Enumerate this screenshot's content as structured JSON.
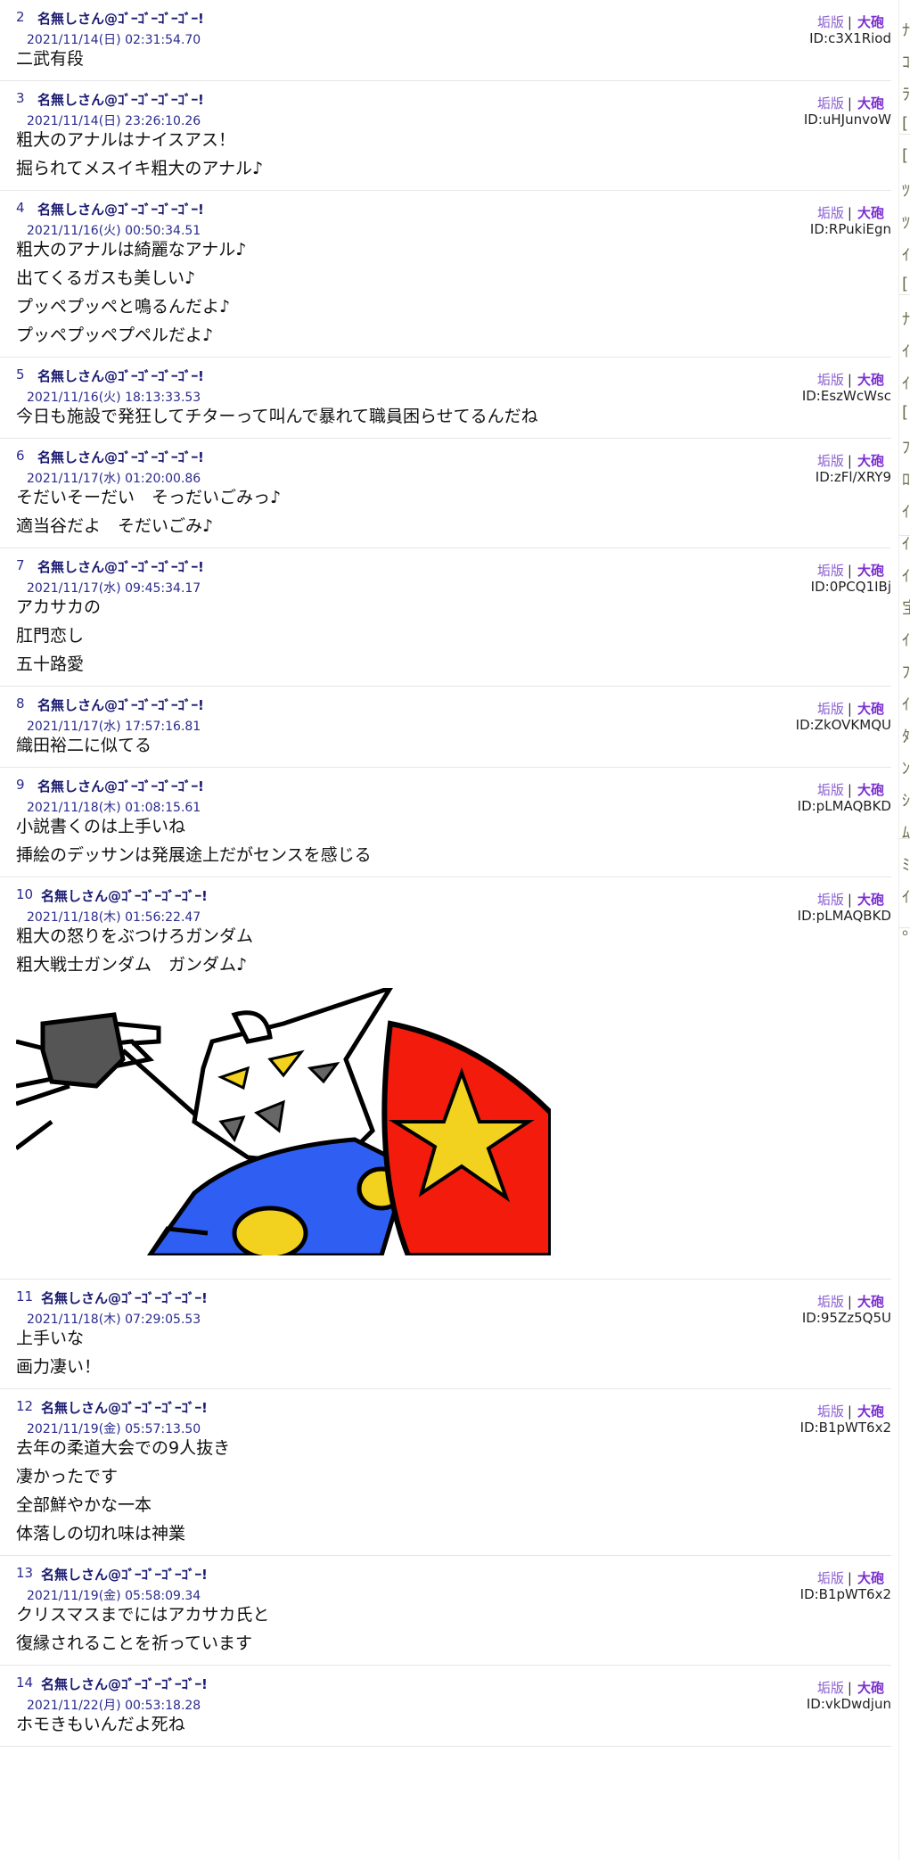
{
  "links": {
    "res": "垢版",
    "separator": "|",
    "cannon": "大砲"
  },
  "posts": [
    {
      "no": "2",
      "name": "名無しさん@ｺﾞｰｺﾞｰｺﾞｰｺﾞｰ!",
      "date": "2021/11/14(日) 02:31:54.70",
      "id": "ID:c3X1Riod",
      "lines": [
        "二武有段"
      ]
    },
    {
      "no": "3",
      "name": "名無しさん@ｺﾞｰｺﾞｰｺﾞｰｺﾞｰ!",
      "date": "2021/11/14(日) 23:26:10.26",
      "id": "ID:uHJunvoW",
      "lines": [
        "粗大のアナルはナイスアス！",
        "掘られてメスイキ粗大のアナル♪"
      ]
    },
    {
      "no": "4",
      "name": "名無しさん@ｺﾞｰｺﾞｰｺﾞｰｺﾞｰ!",
      "date": "2021/11/16(火) 00:50:34.51",
      "id": "ID:RPukiEgn",
      "lines": [
        "粗大のアナルは綺麗なアナル♪",
        "出てくるガスも美しい♪",
        "プッペプッペと鳴るんだよ♪",
        "プッペプッペプペルだよ♪"
      ]
    },
    {
      "no": "5",
      "name": "名無しさん@ｺﾞｰｺﾞｰｺﾞｰｺﾞｰ!",
      "date": "2021/11/16(火) 18:13:33.53",
      "id": "ID:EszWcWsc",
      "lines": [
        "今日も施設で発狂してチターって叫んで暴れて職員困らせてるんだね"
      ]
    },
    {
      "no": "6",
      "name": "名無しさん@ｺﾞｰｺﾞｰｺﾞｰｺﾞｰ!",
      "date": "2021/11/17(水) 01:20:00.86",
      "id": "ID:zFl/XRY9",
      "lines": [
        "そだいそーだい　そっだいごみっ♪",
        "適当谷だよ　そだいごみ♪"
      ]
    },
    {
      "no": "7",
      "name": "名無しさん@ｺﾞｰｺﾞｰｺﾞｰｺﾞｰ!",
      "date": "2021/11/17(水) 09:45:34.17",
      "id": "ID:0PCQ1IBj",
      "lines": [
        "アカサカの",
        "肛門恋し",
        "五十路愛"
      ]
    },
    {
      "no": "8",
      "name": "名無しさん@ｺﾞｰｺﾞｰｺﾞｰｺﾞｰ!",
      "date": "2021/11/17(水) 17:57:16.81",
      "id": "ID:ZkOVKMQU",
      "lines": [
        "織田裕二に似てる"
      ]
    },
    {
      "no": "9",
      "name": "名無しさん@ｺﾞｰｺﾞｰｺﾞｰｺﾞｰ!",
      "date": "2021/11/18(木) 01:08:15.61",
      "id": "ID:pLMAQBKD",
      "lines": [
        "小説書くのは上手いね",
        "挿絵のデッサンは発展途上だがセンスを感じる"
      ]
    },
    {
      "no": "10",
      "name": "名無しさん@ｺﾞｰｺﾞｰｺﾞｰｺﾞｰ!",
      "date": "2021/11/18(木) 01:56:22.47",
      "id": "ID:pLMAQBKD",
      "lines": [
        "粗大の怒りをぶつけろガンダム",
        "粗大戦士ガンダム　ガンダム♪"
      ],
      "has_image": true
    },
    {
      "no": "11",
      "name": "名無しさん@ｺﾞｰｺﾞｰｺﾞｰｺﾞｰ!",
      "date": "2021/11/18(木) 07:29:05.53",
      "id": "ID:95Zz5Q5U",
      "lines": [
        "上手いな",
        "画力凄い！"
      ]
    },
    {
      "no": "12",
      "name": "名無しさん@ｺﾞｰｺﾞｰｺﾞｰｺﾞｰ!",
      "date": "2021/11/19(金) 05:57:13.50",
      "id": "ID:B1pWT6x2",
      "lines": [
        "去年の柔道大会での9人抜き",
        "凄かったです",
        "全部鮮やかな一本",
        "体落しの切れ味は神業"
      ]
    },
    {
      "no": "13",
      "name": "名無しさん@ｺﾞｰｺﾞｰｺﾞｰｺﾞｰ!",
      "date": "2021/11/19(金) 05:58:09.34",
      "id": "ID:B1pWT6x2",
      "lines": [
        "クリスマスまでにはアカサカ氏と",
        "復縁されることを祈っています"
      ]
    },
    {
      "no": "14",
      "name": "名無しさん@ｺﾞｰｺﾞｰｺﾞｰｺﾞｰ!",
      "date": "2021/11/22(月) 00:53:18.28",
      "id": "ID:vkDwdjun",
      "lines": [
        "ホモきもいんだよ死ね"
      ]
    }
  ],
  "side_glyphs": [
    "ﾅ",
    "ｺ",
    "ﾗ",
    "[",
    "[",
    "ﾂ",
    "ﾂ",
    "ｲ",
    "[",
    "ﾅ",
    "ｲ",
    "ｲ",
    "[",
    "ﾌ",
    "ﾛ",
    "ｲ",
    "ｲ",
    "ｲ",
    "宝",
    "ｲ",
    "ﾌ",
    "ｲ",
    "ﾀ",
    "ﾝ",
    "ｼ",
    "ﾑ",
    "ﾐ",
    "ｲ",
    "。"
  ],
  "colors": {
    "name": "#1a1a70",
    "meta": "#2a2a8c",
    "res_link": "#8a5fd0",
    "cannon_link": "#7c2fd0"
  }
}
